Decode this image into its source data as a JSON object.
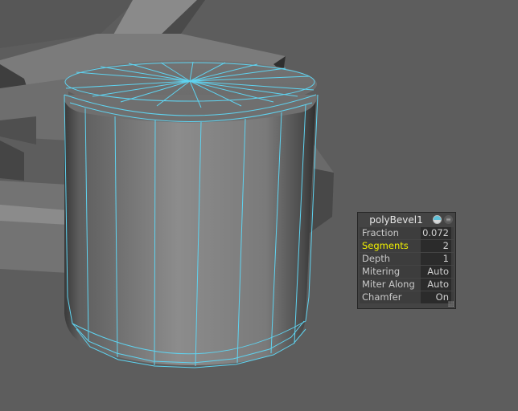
{
  "scene": {
    "object": "bevelled-cylinder",
    "wireframe_color": "#5fd3f0",
    "background_color": "#5d5d5d"
  },
  "bevel_panel": {
    "title": "polyBevel1",
    "title_icon": "node-icon",
    "menu_icon": "menu-icon",
    "rows": [
      {
        "label": "Fraction",
        "value": "0.072",
        "highlighted": false
      },
      {
        "label": "Segments",
        "value": "2",
        "highlighted": true
      },
      {
        "label": "Depth",
        "value": "1",
        "highlighted": false
      },
      {
        "label": "Mitering",
        "value": "Auto",
        "highlighted": false
      },
      {
        "label": "Miter Along",
        "value": "Auto",
        "highlighted": false
      },
      {
        "label": "Chamfer",
        "value": "On",
        "highlighted": false
      }
    ],
    "highlight_color": "#f0f000"
  }
}
